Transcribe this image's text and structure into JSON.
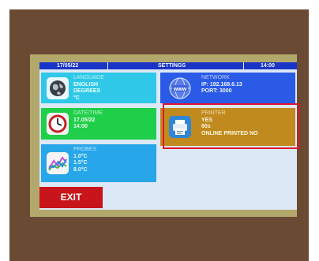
{
  "topbar": {
    "date": "17/05/22",
    "title": "SETTINGS",
    "time": "14:00"
  },
  "tiles": {
    "language": {
      "label": "LANGUAGE",
      "line1": "ENGLISH",
      "line2": "DEGREES",
      "line3": "°C",
      "icon": "globe-icon"
    },
    "datetime": {
      "label": "DATE/TIME",
      "line1": "17.05/22",
      "line2": "14:00",
      "icon": "clock-icon"
    },
    "probes": {
      "label": "PROBES",
      "line1": "1.0°C",
      "line2": "1.5°C",
      "line3": "8.0°C",
      "icon": "chart-icon"
    },
    "network": {
      "label": "NETWORK",
      "line1": "IP: 192.168.6.13",
      "line2": "PORT: 3000",
      "icon": "www-icon"
    },
    "printer": {
      "label": "PRINTER",
      "line1": "YES",
      "line2": "60s",
      "line3": "ONLINE PRINTED NO",
      "icon": "printer-icon"
    }
  },
  "exit_button": "EXIT",
  "colors": {
    "frame": "#6b4a34",
    "bezel": "#b3a86c",
    "topbar": "#1a34c7",
    "highlight": "#e2142c",
    "exit": "#c8151b"
  }
}
